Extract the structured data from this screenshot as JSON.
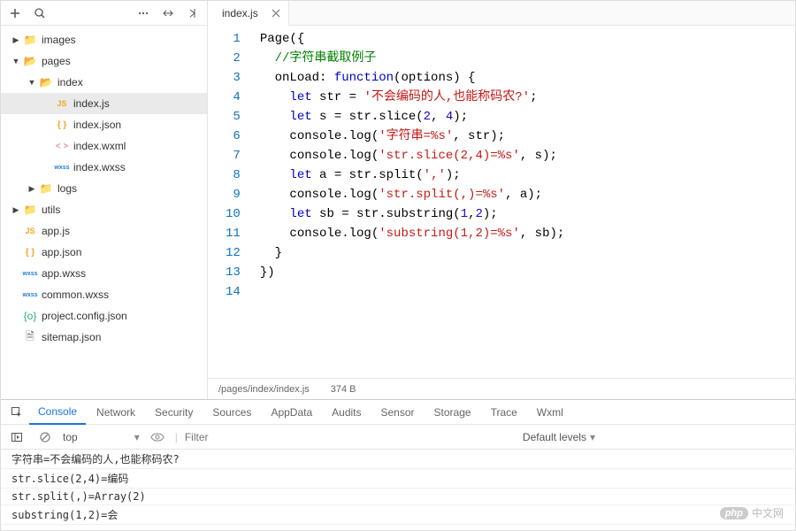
{
  "sidebar": {
    "items": [
      {
        "indent": 0,
        "arrow": "▶",
        "iconClass": "ic-folder",
        "iconText": "📁",
        "label": "images"
      },
      {
        "indent": 0,
        "arrow": "▼",
        "iconClass": "ic-folder",
        "iconText": "📂",
        "label": "pages"
      },
      {
        "indent": 1,
        "arrow": "▼",
        "iconClass": "ic-folder",
        "iconText": "📂",
        "label": "index"
      },
      {
        "indent": 2,
        "arrow": "",
        "iconClass": "ic-js",
        "iconText": "JS",
        "label": "index.js",
        "selected": true
      },
      {
        "indent": 2,
        "arrow": "",
        "iconClass": "ic-json",
        "iconText": "{ }",
        "label": "index.json"
      },
      {
        "indent": 2,
        "arrow": "",
        "iconClass": "ic-wxml",
        "iconText": "< >",
        "label": "index.wxml"
      },
      {
        "indent": 2,
        "arrow": "",
        "iconClass": "ic-wxss",
        "iconText": "wxss",
        "label": "index.wxss"
      },
      {
        "indent": 1,
        "arrow": "▶",
        "iconClass": "ic-folder",
        "iconText": "📁",
        "label": "logs"
      },
      {
        "indent": 0,
        "arrow": "▶",
        "iconClass": "ic-folder",
        "iconText": "📁",
        "label": "utils"
      },
      {
        "indent": 0,
        "arrow": "",
        "iconClass": "ic-js",
        "iconText": "JS",
        "label": "app.js"
      },
      {
        "indent": 0,
        "arrow": "",
        "iconClass": "ic-json",
        "iconText": "{ }",
        "label": "app.json"
      },
      {
        "indent": 0,
        "arrow": "",
        "iconClass": "ic-wxss",
        "iconText": "wxss",
        "label": "app.wxss"
      },
      {
        "indent": 0,
        "arrow": "",
        "iconClass": "ic-wxss",
        "iconText": "wxss",
        "label": "common.wxss"
      },
      {
        "indent": 0,
        "arrow": "",
        "iconClass": "ic-config",
        "iconText": "{o}",
        "label": "project.config.json"
      },
      {
        "indent": 0,
        "arrow": "",
        "iconClass": "ic-folder",
        "iconText": "🗎",
        "label": "sitemap.json"
      }
    ]
  },
  "tab": {
    "title": "index.js"
  },
  "code": {
    "lines": [
      [
        {
          "c": "tok-id",
          "t": "Page({"
        }
      ],
      [
        {
          "c": "tok-id",
          "t": "  "
        },
        {
          "c": "tok-com",
          "t": "//字符串截取例子"
        }
      ],
      [
        {
          "c": "tok-id",
          "t": "  onLoad: "
        },
        {
          "c": "tok-fn",
          "t": "function"
        },
        {
          "c": "tok-id",
          "t": "(options) {"
        }
      ],
      [
        {
          "c": "tok-id",
          "t": "    "
        },
        {
          "c": "tok-kw",
          "t": "let"
        },
        {
          "c": "tok-id",
          "t": " str = "
        },
        {
          "c": "tok-str",
          "t": "'不会编码的人,也能称码农?'"
        },
        {
          "c": "tok-id",
          "t": ";"
        }
      ],
      [
        {
          "c": "tok-id",
          "t": "    "
        },
        {
          "c": "tok-kw",
          "t": "let"
        },
        {
          "c": "tok-id",
          "t": " s = str.slice("
        },
        {
          "c": "tok-num",
          "t": "2"
        },
        {
          "c": "tok-id",
          "t": ", "
        },
        {
          "c": "tok-num",
          "t": "4"
        },
        {
          "c": "tok-id",
          "t": ");"
        }
      ],
      [
        {
          "c": "tok-id",
          "t": "    console.log("
        },
        {
          "c": "tok-str",
          "t": "'字符串=%s'"
        },
        {
          "c": "tok-id",
          "t": ", str);"
        }
      ],
      [
        {
          "c": "tok-id",
          "t": "    console.log("
        },
        {
          "c": "tok-str",
          "t": "'str.slice(2,4)=%s'"
        },
        {
          "c": "tok-id",
          "t": ", s);"
        }
      ],
      [
        {
          "c": "tok-id",
          "t": "    "
        },
        {
          "c": "tok-kw",
          "t": "let"
        },
        {
          "c": "tok-id",
          "t": " a = str.split("
        },
        {
          "c": "tok-str",
          "t": "','"
        },
        {
          "c": "tok-id",
          "t": ");"
        }
      ],
      [
        {
          "c": "tok-id",
          "t": "    console.log("
        },
        {
          "c": "tok-str",
          "t": "'str.split(,)=%s'"
        },
        {
          "c": "tok-id",
          "t": ", a);"
        }
      ],
      [
        {
          "c": "tok-id",
          "t": "    "
        },
        {
          "c": "tok-kw",
          "t": "let"
        },
        {
          "c": "tok-id",
          "t": " sb = str.substring("
        },
        {
          "c": "tok-num",
          "t": "1"
        },
        {
          "c": "tok-id",
          "t": ","
        },
        {
          "c": "tok-num",
          "t": "2"
        },
        {
          "c": "tok-id",
          "t": ");"
        }
      ],
      [
        {
          "c": "tok-id",
          "t": "    console.log("
        },
        {
          "c": "tok-str",
          "t": "'substring(1,2)=%s'"
        },
        {
          "c": "tok-id",
          "t": ", sb);"
        }
      ],
      [
        {
          "c": "tok-id",
          "t": "  }"
        }
      ],
      [
        {
          "c": "tok-id",
          "t": "})"
        }
      ],
      [
        {
          "c": "tok-id",
          "t": ""
        }
      ]
    ]
  },
  "status": {
    "path": "/pages/index/index.js",
    "size": "374 B"
  },
  "devtools": {
    "tabs": [
      "Console",
      "Network",
      "Security",
      "Sources",
      "AppData",
      "Audits",
      "Sensor",
      "Storage",
      "Trace",
      "Wxml"
    ],
    "active": "Console",
    "context": "top",
    "filter_placeholder": "Filter",
    "levels": "Default levels",
    "logs": [
      "字符串=不会编码的人,也能称码农?",
      "str.slice(2,4)=编码",
      "str.split(,)=Array(2)",
      "substring(1,2)=会"
    ]
  },
  "watermark": {
    "brand": "php",
    "text": "中文网"
  }
}
